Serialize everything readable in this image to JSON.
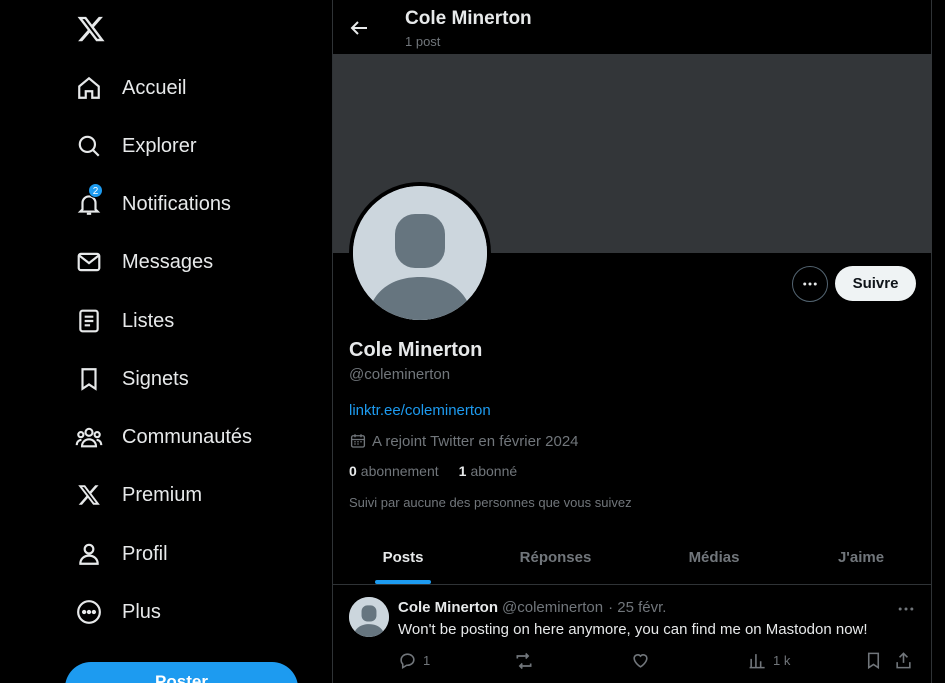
{
  "sidebar": {
    "items": [
      {
        "label": "Accueil",
        "icon": "home-icon"
      },
      {
        "label": "Explorer",
        "icon": "search-icon"
      },
      {
        "label": "Notifications",
        "icon": "bell-icon",
        "badge": "2"
      },
      {
        "label": "Messages",
        "icon": "mail-icon"
      },
      {
        "label": "Listes",
        "icon": "list-icon"
      },
      {
        "label": "Signets",
        "icon": "bookmark-icon"
      },
      {
        "label": "Communautés",
        "icon": "communities-icon"
      },
      {
        "label": "Premium",
        "icon": "x-logo-icon"
      },
      {
        "label": "Profil",
        "icon": "person-icon"
      },
      {
        "label": "Plus",
        "icon": "more-circle-icon"
      }
    ],
    "post_label": "Poster"
  },
  "header": {
    "name": "Cole Minerton",
    "post_count": "1 post"
  },
  "profile": {
    "name": "Cole Minerton",
    "handle": "@coleminerton",
    "link": "linktr.ee/coleminerton",
    "joined": "A rejoint Twitter en février 2024",
    "following_count": "0",
    "following_label": "abonnement",
    "followers_count": "1",
    "followers_label": "abonné",
    "followed_by": "Suivi par aucune des personnes que vous suivez",
    "follow_label": "Suivre"
  },
  "tabs": [
    {
      "label": "Posts",
      "active": true
    },
    {
      "label": "Réponses"
    },
    {
      "label": "Médias"
    },
    {
      "label": "J'aime"
    }
  ],
  "tweet": {
    "name": "Cole Minerton",
    "handle": "@coleminerton",
    "date": "· 25 févr.",
    "text": "Won't be posting on here anymore, you can find me on Mastodon now!",
    "replies": "1",
    "views": "1 k"
  },
  "colors": {
    "accent": "#1d9bf0",
    "background": "#000000",
    "banner": "#333639",
    "text": "#e7e9ea",
    "muted": "#71767b"
  }
}
